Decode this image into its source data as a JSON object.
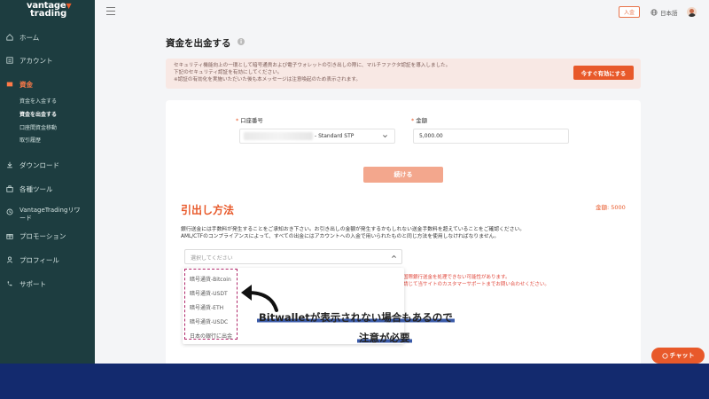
{
  "brand": {
    "line1": "vantage",
    "line2": "trading",
    "accent": "#e8592a"
  },
  "header": {
    "login_label": "入金",
    "language": "日本語"
  },
  "sidebar": {
    "items": [
      {
        "label": "ホーム",
        "icon": "home-icon"
      },
      {
        "label": "アカウント",
        "icon": "account-icon"
      },
      {
        "label": "資金",
        "icon": "funds-icon",
        "active": true
      },
      {
        "label": "ダウンロード",
        "icon": "download-icon"
      },
      {
        "label": "各種ツール",
        "icon": "tools-icon"
      },
      {
        "label": "VantageTradingリワード",
        "icon": "reward-icon"
      },
      {
        "label": "プロモーション",
        "icon": "promotion-icon"
      },
      {
        "label": "プロフィール",
        "icon": "profile-icon"
      },
      {
        "label": "サポート",
        "icon": "support-icon"
      }
    ],
    "sub_items": [
      {
        "label": "資金を入金する"
      },
      {
        "label": "資金を出金する",
        "active": true
      },
      {
        "label": "口座間資金移動"
      },
      {
        "label": "取引履歴"
      }
    ]
  },
  "page": {
    "title": "資金を出金する",
    "notice": {
      "lines": [
        "セキュリティ機能向上の一環として暗号通貨および電子ウォレットの引き出しの際に、マルチファクタ認証を導入しました。",
        "下記のセキュリティ認証を有効にしてください。",
        "※認証の有効化を実施いただいた後も本メッセージは注意喚起のため表示されます。"
      ],
      "button": "今すぐ有効にする"
    },
    "form": {
      "account_label": "口座番号",
      "account_value": "- Standard STP",
      "amount_label": "金額",
      "amount_value": "5,000.00",
      "continue": "続ける"
    },
    "method": {
      "title": "引出し方法",
      "amount": "金額: 5000",
      "desc_lines": [
        "銀行送金には手数料が発生することをご承知おき下さい。お引き出しの金額が発生するかもしれない送金手数料を超えていることをご確認ください。",
        "AML/CTFのコンプライアンスによって、すべての出金にはアカウントへの入金で用いられたものと同じ方法を使用しなければなりません。"
      ],
      "placeholder": "選択してください",
      "options": [
        "暗号通貨-Bitcoin",
        "暗号通貨-USDT",
        "暗号通貨-ETH",
        "暗号通貨-USDC",
        "日本の銀行に出金"
      ],
      "warnings": [
        "国際銀行送金を処理できない可能性があります。",
        "請じて当サイトのカスタマーサポートまでお問い合わせください。"
      ]
    }
  },
  "annotation": {
    "line1": "Bitwalletが表示されない場合もあるので",
    "line2": "注意が必要"
  },
  "chat": {
    "label": "チャット"
  }
}
